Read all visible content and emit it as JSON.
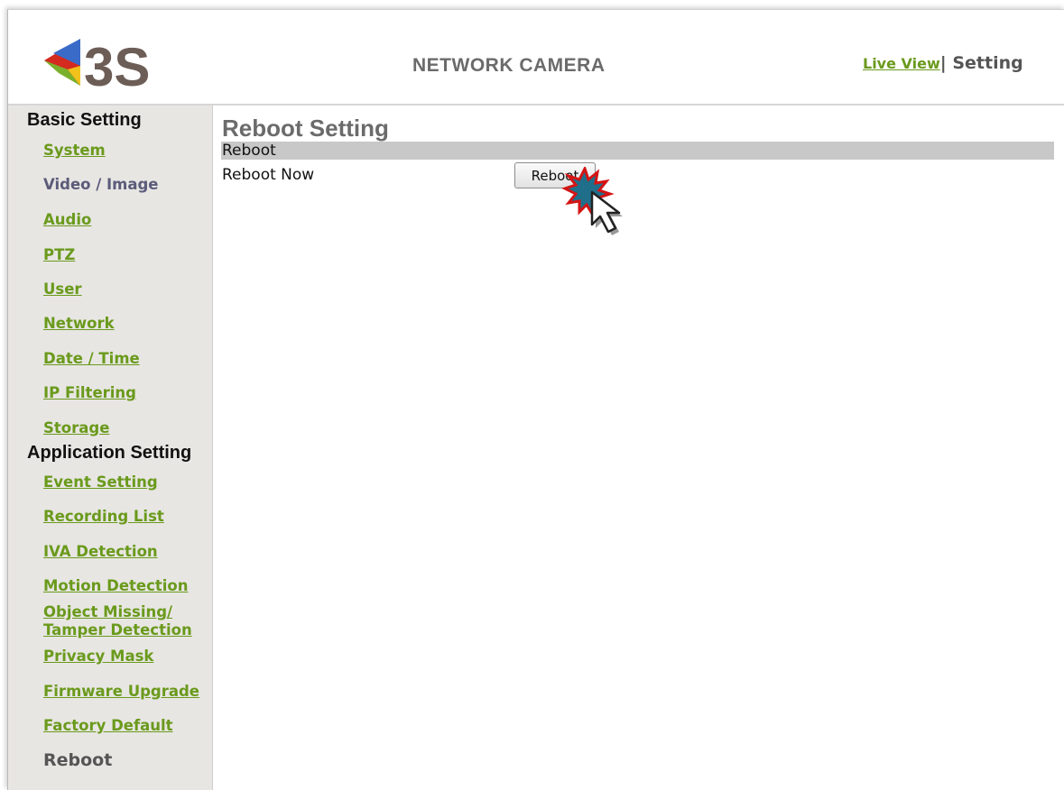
{
  "header": {
    "logo_text": "3S",
    "title": "NETWORK CAMERA",
    "nav_live": "Live View",
    "nav_sep": "|",
    "nav_setting": "Setting"
  },
  "sidebar": {
    "basic_heading": "Basic Setting",
    "basic_items": [
      {
        "label": "System"
      },
      {
        "label": "Video / Image"
      },
      {
        "label": "Audio"
      },
      {
        "label": "PTZ"
      },
      {
        "label": "User"
      },
      {
        "label": "Network"
      },
      {
        "label": "Date / Time"
      },
      {
        "label": "IP Filtering"
      },
      {
        "label": "Storage"
      }
    ],
    "app_heading": "Application Setting",
    "app_items": [
      {
        "label": "Event Setting"
      },
      {
        "label": "Recording List"
      },
      {
        "label": "IVA Detection"
      },
      {
        "label": "Motion Detection"
      },
      {
        "label": "Object Missing/"
      },
      {
        "label": "Tamper Detection"
      },
      {
        "label": "Privacy Mask"
      },
      {
        "label": "Firmware Upgrade"
      },
      {
        "label": "Factory Default"
      },
      {
        "label": "Reboot"
      }
    ]
  },
  "main": {
    "title": "Reboot Setting",
    "section": "Reboot",
    "row_label": "Reboot Now",
    "button_label": "Reboot"
  },
  "colors": {
    "link": "#6a9a1c",
    "sidebar_bg": "#e8e6e3",
    "section_bar": "#c8c8c8",
    "heading_gray": "#6b6b6b"
  }
}
